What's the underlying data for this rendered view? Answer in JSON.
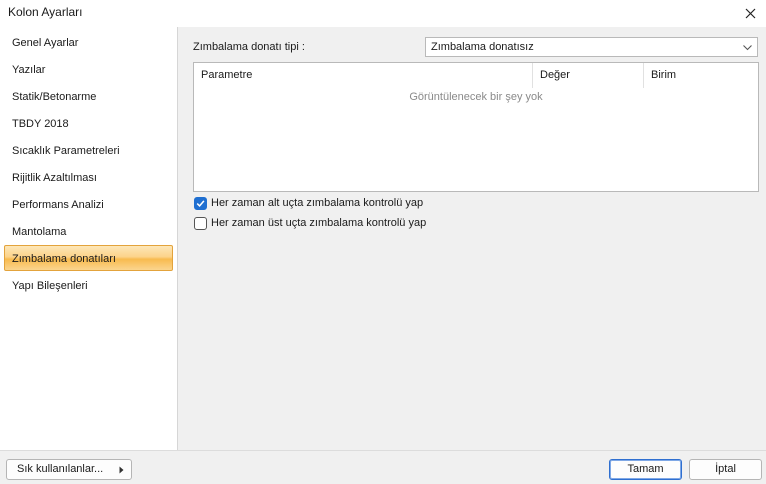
{
  "window": {
    "title": "Kolon Ayarları"
  },
  "sidebar": {
    "items": [
      {
        "label": "Genel Ayarlar"
      },
      {
        "label": "Yazılar"
      },
      {
        "label": "Statik/Betonarme"
      },
      {
        "label": "TBDY 2018"
      },
      {
        "label": "Sıcaklık Parametreleri"
      },
      {
        "label": "Rijitlik Azaltılması"
      },
      {
        "label": "Performans Analizi"
      },
      {
        "label": "Mantolama"
      },
      {
        "label": "Zımbalama donatıları"
      },
      {
        "label": "Yapı Bileşenleri"
      }
    ],
    "selected_index": 8
  },
  "main": {
    "type_label": "Zımbalama donatı tipi :",
    "type_value": "Zımbalama donatısız",
    "grid": {
      "columns": [
        "Parametre",
        "Değer",
        "Birim"
      ],
      "empty_text": "Görüntülenecek bir şey yok"
    },
    "checks": [
      {
        "label": "Her zaman alt uçta zımbalama kontrolü yap",
        "checked": true
      },
      {
        "label": "Her zaman üst uçta zımbalama kontrolü yap",
        "checked": false
      }
    ]
  },
  "footer": {
    "favorites_label": "Sık kullanılanlar...",
    "ok_label": "Tamam",
    "cancel_label": "İptal"
  },
  "icons": {
    "close": "close-icon",
    "dropdown": "chevron-down-icon",
    "submenu": "chevron-right-icon",
    "check": "checkmark-icon"
  },
  "colors": {
    "accent": "#1f6fd1",
    "selection": "#f8bb4f"
  }
}
